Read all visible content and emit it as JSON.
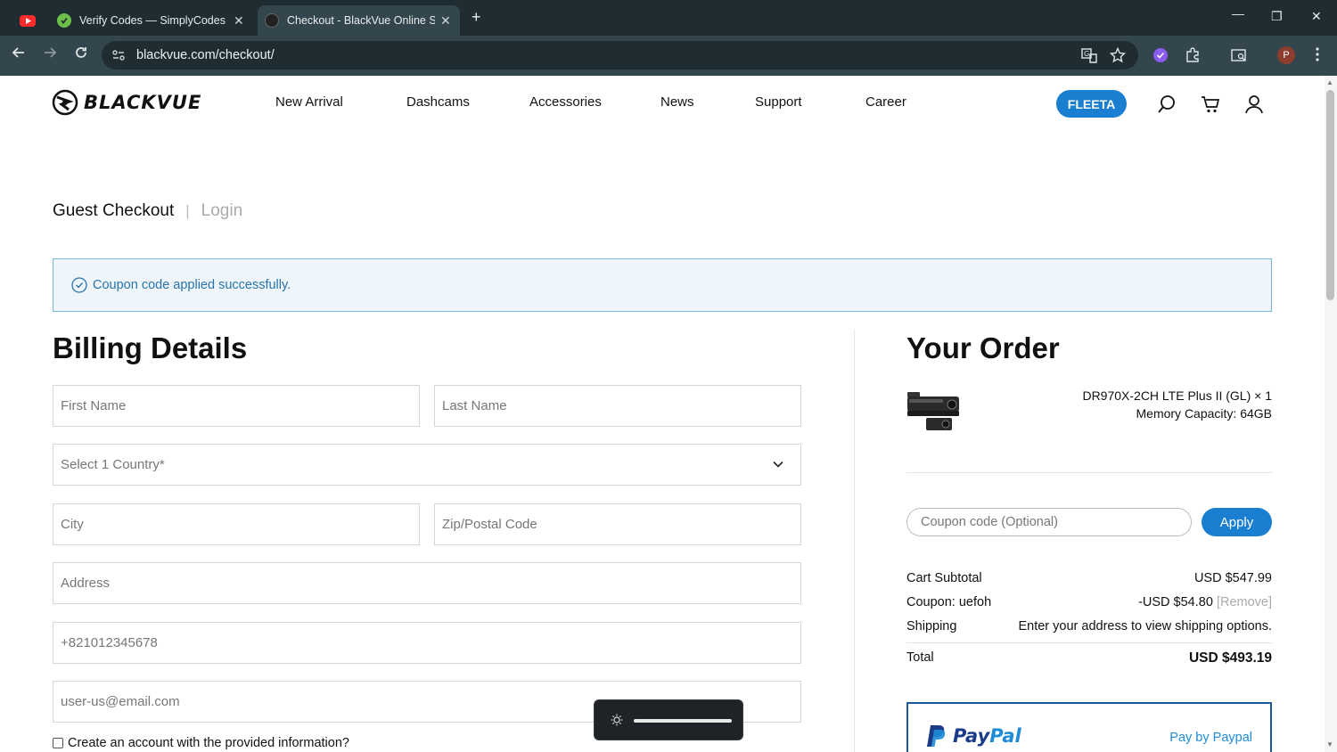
{
  "browser": {
    "tabs": [
      {
        "title": "",
        "icon": "youtube-icon"
      },
      {
        "title": "Verify Codes — SimplyCodes",
        "icon": "simplycodes-icon"
      },
      {
        "title": "Checkout - BlackVue Online Sto",
        "icon": "blackvue-icon"
      }
    ],
    "url": "blackvue.com/checkout/",
    "profile_initial": "P"
  },
  "header": {
    "logo_text": "BLACKVUE",
    "nav": [
      "New Arrival",
      "Dashcams",
      "Accessories",
      "News",
      "Support",
      "Career"
    ],
    "fleeta_label": "FLEETA"
  },
  "checkout_tabs": {
    "guest": "Guest Checkout",
    "separator": "|",
    "login": "Login"
  },
  "notice": {
    "message": "Coupon code applied successfully."
  },
  "billing": {
    "title": "Billing Details",
    "first_name_placeholder": "First Name",
    "last_name_placeholder": "Last Name",
    "country_placeholder": "Select 1 Country*",
    "city_placeholder": "City",
    "zip_placeholder": "Zip/Postal Code",
    "address_placeholder": "Address",
    "phone_placeholder": "+821012345678",
    "email_placeholder": "user-us@email.com",
    "create_account_label": "Create an account with the provided information?"
  },
  "order": {
    "title": "Your Order",
    "product_line1": "DR970X-2CH LTE Plus II (GL) × 1",
    "product_line2": "Memory Capacity: 64GB",
    "coupon_placeholder": "Coupon code (Optional)",
    "apply_label": "Apply",
    "subtotal_label": "Cart Subtotal",
    "subtotal_value": "USD $547.99",
    "coupon_label": "Coupon: uefoh",
    "coupon_value": "-USD $54.80",
    "remove_label": "[Remove]",
    "shipping_label": "Shipping",
    "shipping_value": "Enter your address to view shipping options.",
    "total_label": "Total",
    "total_value": "USD $493.19",
    "paypal_pay": "Pay",
    "paypal_pal": "Pal",
    "paypal_pay_by": "Pay by Paypal"
  },
  "overlay": {
    "brightness_level": 1.0
  },
  "colors": {
    "accent": "#1a7fd0",
    "notice_bg": "#eef6fb",
    "notice_text": "#2a73a8",
    "chrome_dark": "#1f2d33",
    "chrome_mid": "#34464d"
  }
}
